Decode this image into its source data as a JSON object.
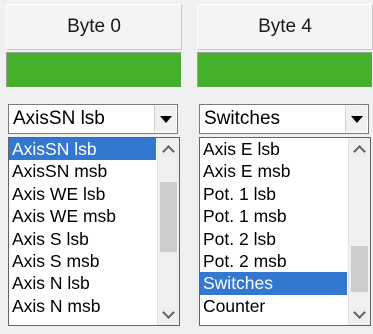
{
  "left": {
    "header": "Byte 0",
    "bar_color": "#44b02c",
    "selected_value": "AxisSN lsb",
    "items": [
      "AxisSN lsb",
      "AxisSN msb",
      "Axis WE lsb",
      "Axis WE msb",
      "Axis S lsb",
      "Axis S msb",
      "Axis N lsb",
      "Axis N msb"
    ],
    "selected_index": 0
  },
  "right": {
    "header": "Byte 4",
    "bar_color": "#44b02c",
    "selected_value": "Switches",
    "items": [
      "Axis E lsb",
      "Axis E msb",
      "Pot. 1 lsb",
      "Pot. 1 msb",
      "Pot. 2 lsb",
      "Pot. 2 msb",
      "Switches",
      "Counter"
    ],
    "selected_index": 6
  },
  "colors": {
    "selection": "#3378d0",
    "scroll_thumb": "#cdcdcd"
  },
  "icons": {
    "dropdown": "chevron-down-icon",
    "scroll_up": "chevron-up-icon",
    "scroll_down": "chevron-down-icon"
  }
}
